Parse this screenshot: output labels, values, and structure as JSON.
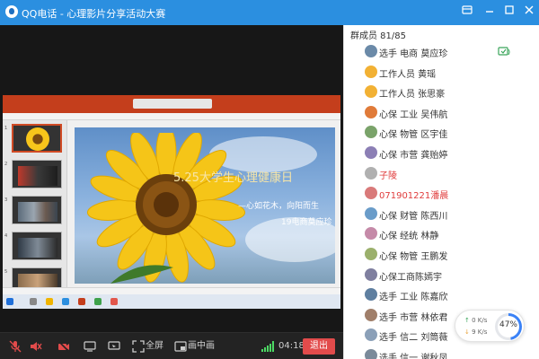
{
  "window": {
    "title": "QQ电话 - 心理影片分享活动大赛",
    "title_bar_color": "#2b8fe0",
    "controls": [
      "minimize-icon",
      "maximize-icon",
      "close-icon"
    ]
  },
  "shared_screen": {
    "app": "PowerPoint",
    "accent_color": "#c43e1c",
    "doc_title": "",
    "slide": {
      "title": "5.25大学生心理健康日",
      "subtitle_1": "—心如花木，向阳而生",
      "subtitle_2": "19电商莫应珍"
    },
    "thumbnail_numbers": [
      "1",
      "2",
      "3",
      "4",
      "5"
    ]
  },
  "controls": {
    "mic_label": "",
    "fullscreen_label": "全屏",
    "pip_label": "画中画",
    "call_time": "04:18",
    "end_label": "退出"
  },
  "panel": {
    "header": "群成员 81/85",
    "members": [
      {
        "name": "选手 电商 莫应珍",
        "red": false
      },
      {
        "name": "工作人员 黄瑶",
        "red": false
      },
      {
        "name": "工作人员 张思豪",
        "red": false
      },
      {
        "name": "心保 工业 吴伟航",
        "red": false
      },
      {
        "name": "心保 物管 区宇佳",
        "red": false
      },
      {
        "name": "心保 市营 龚贻婷",
        "red": false
      },
      {
        "name": "子陵",
        "red": true
      },
      {
        "name": "071901221潘晨",
        "red": true
      },
      {
        "name": "心保 财管 陈西川",
        "red": false
      },
      {
        "name": "心保 经统 林静",
        "red": false
      },
      {
        "name": "心保 物管 王鹏发",
        "red": false
      },
      {
        "name": "心保工商陈嫣宇",
        "red": false
      },
      {
        "name": "选手 工业 陈嘉欣",
        "red": false
      },
      {
        "name": "选手 市营 林依君",
        "red": false
      },
      {
        "name": "选手 信二 刘筒薇",
        "red": false
      },
      {
        "name": "选手 信一 谢秋凤",
        "red": false
      }
    ]
  },
  "network": {
    "up_rate": "0 K/s",
    "down_rate": "9 K/s",
    "percent": "47%"
  }
}
